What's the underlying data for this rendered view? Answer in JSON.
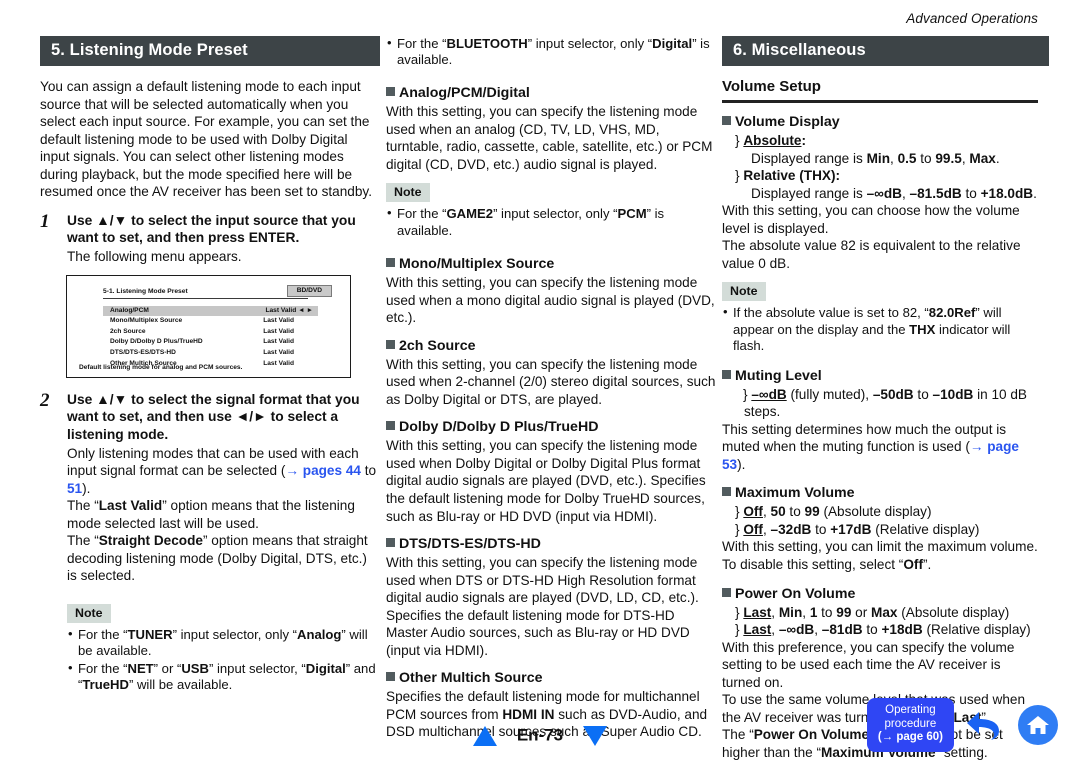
{
  "running_head": "Advanced Operations",
  "col1": {
    "section_title": "5. Listening Mode Preset",
    "intro": "You can assign a default listening mode to each input source that will be selected automatically when you select each input source. For example, you can set the default listening mode to be used with Dolby Digital input signals. You can select other listening modes during playback, but the mode specified here will be resumed once the AV receiver has been set to standby.",
    "step1": {
      "number": "1",
      "title_a": "Use ",
      "title_arrows": "▲/▼",
      "title_b": " to select the input source that you want to set, and then press ENTER.",
      "body": "The following menu appears."
    },
    "osd": {
      "title": "5-1. Listening Mode Preset",
      "badge": "BD/DVD",
      "rows": [
        {
          "label": "Analog/PCM",
          "value": "Last Valid",
          "arrows": "◄ ►",
          "selected": true
        },
        {
          "label": "Mono/Multiplex Source",
          "value": "Last Valid",
          "arrows": "",
          "selected": false
        },
        {
          "label": "2ch Source",
          "value": "Last Valid",
          "arrows": "",
          "selected": false
        },
        {
          "label": "Dolby D/Dolby D Plus/TrueHD",
          "value": "Last Valid",
          "arrows": "",
          "selected": false
        },
        {
          "label": "DTS/DTS-ES/DTS-HD",
          "value": "Last Valid",
          "arrows": "",
          "selected": false
        },
        {
          "label": "Other Multich Source",
          "value": "Last Valid",
          "arrows": "",
          "selected": false
        }
      ],
      "footer": "Default listening mode for analog and PCM sources."
    },
    "step2": {
      "number": "2",
      "title": "Use ▲/▼ to select the signal format that you want to set, and then use ◄/► to select a listening mode.",
      "p1_pre": "Only listening modes that can be used with each input signal format can be selected (",
      "p1_link1": "→ pages 44",
      "p1_mid": " to ",
      "p1_link2": "51",
      "p1_post": ").",
      "p2_pre": "The “",
      "p2_bold": "Last Valid",
      "p2_post": "” option means that the listening mode selected last will be used.",
      "p3_pre": "The “",
      "p3_bold": "Straight Decode",
      "p3_post": "” option means that straight decoding listening mode (Dolby Digital, DTS, etc.) is selected."
    },
    "note": {
      "badge": "Note",
      "items": [
        "For the “TUNER” input selector, only “Analog” will be available.",
        "For the “NET” or “USB” input selector, “Digital” and “TrueHD” will be available."
      ]
    }
  },
  "col2": {
    "top_note_item": "For the “BLUETOOTH” input selector, only “Digital” is available.",
    "sections": [
      {
        "heading": "Analog/PCM/Digital",
        "body": "With this setting, you can specify the listening mode used when an analog (CD, TV, LD, VHS, MD, turntable, radio, cassette, cable, satellite, etc.) or PCM digital (CD, DVD, etc.) audio signal is played."
      },
      {
        "heading": "Mono/Multiplex Source",
        "body": "With this setting, you can specify the listening mode used when a mono digital audio signal is played (DVD, etc.)."
      },
      {
        "heading": "2ch Source",
        "body": "With this setting, you can specify the listening mode used when 2-channel (2/0) stereo digital sources, such as Dolby Digital or DTS, are played."
      },
      {
        "heading": "Dolby D/Dolby D Plus/TrueHD",
        "body": "With this setting, you can specify the listening mode used when Dolby Digital or Dolby Digital Plus format digital audio signals are played (DVD, etc.). Specifies the default listening mode for Dolby TrueHD sources, such as Blu-ray or HD DVD (input via HDMI)."
      },
      {
        "heading": "DTS/DTS-ES/DTS-HD",
        "body": "With this setting, you can specify the listening mode used when DTS or DTS-HD High Resolution format digital audio signals are played (DVD, LD, CD, etc.). Specifies the default listening mode for DTS-HD Master Audio sources, such as Blu-ray or HD DVD (input via HDMI)."
      }
    ],
    "note": {
      "badge": "Note",
      "item": "For the “GAME2” input selector, only “PCM” is available."
    },
    "last_section": {
      "heading": "Other Multich Source",
      "body_pre": "Specifies the default listening mode for multichannel PCM sources from ",
      "body_bold": "HDMI IN",
      "body_post": " such as DVD-Audio, and DSD multichannel sources such as Super Audio CD."
    }
  },
  "col3": {
    "section_title": "6. Miscellaneous",
    "sub_header": "Volume Setup",
    "volume_display": {
      "heading": "Volume Display",
      "opt1_label": "Absolute",
      "opt1_colon": ":",
      "opt1_sub_pre": "Displayed range is ",
      "opt1_sub_b1": "Min",
      "opt1_sub_mid1": ", ",
      "opt1_sub_b2": "0.5",
      "opt1_sub_mid2": " to ",
      "opt1_sub_b3": "99.5",
      "opt1_sub_mid3": ", ",
      "opt1_sub_b4": "Max",
      "opt1_sub_post": ".",
      "opt2_label": "Relative (THX)",
      "opt2_colon": ":",
      "opt2_sub_pre": "Displayed range is ",
      "opt2_sub_b1": "–∞dB",
      "opt2_sub_mid1": ", ",
      "opt2_sub_b2": "–81.5dB",
      "opt2_sub_mid2": " to ",
      "opt2_sub_b3": "+18.0dB",
      "opt2_sub_post": ".",
      "p1": "With this setting, you can choose how the volume level is displayed.",
      "p2": "The absolute value 82 is equivalent to the relative value 0 dB."
    },
    "note": {
      "badge": "Note",
      "item_pre": "If the absolute value is set to 82, “",
      "item_b1": "82.0Ref",
      "item_mid": "” will appear on the display and the ",
      "item_b2": "THX",
      "item_post": " indicator will flash."
    },
    "muting_level": {
      "heading": "Muting Level",
      "opt_b1": "–∞dB",
      "opt_mid1": " (fully muted), ",
      "opt_b2": "–50dB",
      "opt_mid2": " to ",
      "opt_b3": "–10dB",
      "opt_post": " in 10 dB steps.",
      "body_pre": "This setting determines how much the output is muted when the muting function is used (",
      "body_link": "→ page 53",
      "body_post": ")."
    },
    "maximum_volume": {
      "heading": "Maximum Volume",
      "opt1_b1": "Off",
      "opt1_mid1": ", ",
      "opt1_b2": "50",
      "opt1_mid2": " to ",
      "opt1_b3": "99",
      "opt1_post": " (Absolute display)",
      "opt2_b1": "Off",
      "opt2_mid1": ", ",
      "opt2_b2": "–32dB",
      "opt2_mid2": " to ",
      "opt2_b3": "+17dB",
      "opt2_post": " (Relative display)",
      "body_pre": "With this setting, you can limit the maximum volume. To disable this setting, select “",
      "body_bold": "Off",
      "body_post": "”."
    },
    "power_on_volume": {
      "heading": "Power On Volume",
      "opt1_b1": "Last",
      "opt1_mid1": ", ",
      "opt1_b2": "Min",
      "opt1_mid2": ", ",
      "opt1_b3": "1",
      "opt1_mid3": " to ",
      "opt1_b4": "99",
      "opt1_mid4": " or ",
      "opt1_b5": "Max",
      "opt1_post": " (Absolute display)",
      "opt2_b1": "Last",
      "opt2_mid1": ", ",
      "opt2_b2": "–∞dB",
      "opt2_mid2": ", ",
      "opt2_b3": "–81dB",
      "opt2_mid3": " to ",
      "opt2_b4": "+18dB",
      "opt2_post": " (Relative display)",
      "p1": "With this preference, you can specify the volume setting to be used each time the AV receiver is turned on.",
      "p2_pre": "To use the same volume level that was used when the AV receiver was turned off, select “",
      "p2_bold": "Last",
      "p2_post": "”.",
      "p3_pre": "The “",
      "p3_b1": "Power On Volume",
      "p3_mid": "” setting cannot be set higher than the “",
      "p3_b2": "Maximum Volume",
      "p3_post": "” setting."
    }
  },
  "footer": {
    "page_label": "En-73",
    "operating_line1": "Operating",
    "operating_line2": "procedure",
    "operating_line3": "(→ page 60)"
  },
  "colors": {
    "section_bar": "#3d4447",
    "note_badge": "#d3dcd8",
    "link_blue": "#2a55ef",
    "footer_triangle": "#0b6ff5",
    "op_button": "#2f46f4",
    "home_icon": "#2f7df4",
    "square_bullet": "#515b5e"
  }
}
